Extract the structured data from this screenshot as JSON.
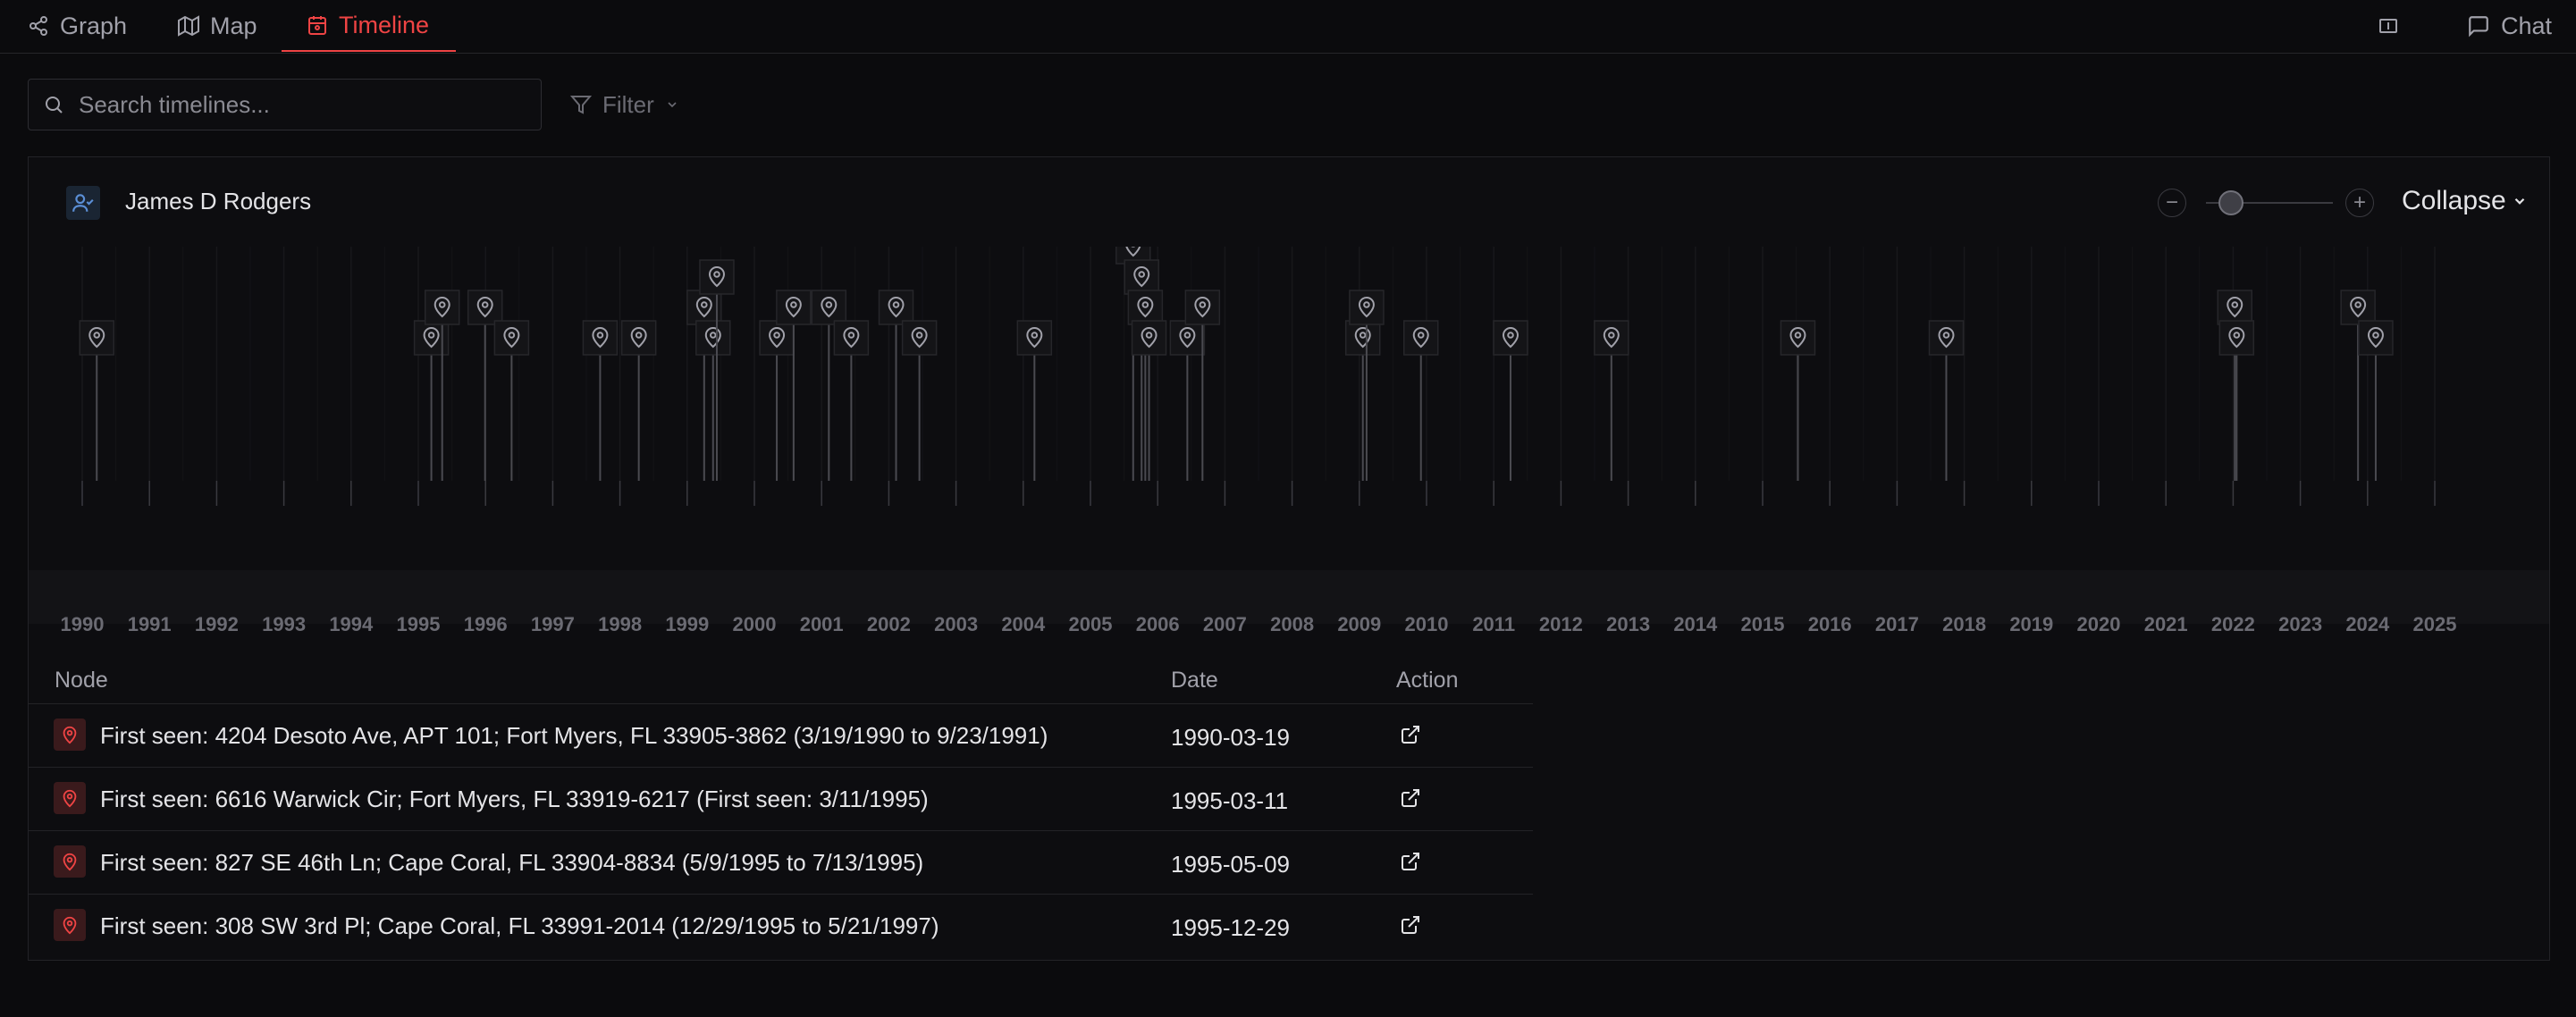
{
  "tabs": [
    {
      "label": "Graph",
      "icon": "graph-icon",
      "active": false
    },
    {
      "label": "Map",
      "icon": "map-icon",
      "active": false
    },
    {
      "label": "Timeline",
      "icon": "calendar-icon",
      "active": true
    }
  ],
  "header_right": {
    "chat_label": "Chat"
  },
  "search": {
    "placeholder": "Search timelines...",
    "value": ""
  },
  "filter": {
    "label": "Filter"
  },
  "timeline": {
    "person_name": "James D Rodgers",
    "collapse_label": "Collapse",
    "zoom_level": 0.2,
    "years": [
      "1990",
      "1991",
      "1992",
      "1993",
      "1994",
      "1995",
      "1996",
      "1997",
      "1998",
      "1999",
      "2000",
      "2001",
      "2002",
      "2003",
      "2004",
      "2005",
      "2006",
      "2007",
      "2008",
      "2009",
      "2010",
      "2011",
      "2012",
      "2013",
      "2014",
      "2015",
      "2016",
      "2017",
      "2018",
      "2019",
      "2020",
      "2021",
      "2022",
      "2023",
      "2024",
      "2025"
    ],
    "events": [
      {
        "date": "1990-03-19",
        "tier": 0
      },
      {
        "date": "1995-03-11",
        "tier": 0
      },
      {
        "date": "1995-05-09",
        "tier": 1
      },
      {
        "date": "1995-12-29",
        "tier": 1
      },
      {
        "date": "1996-05-21",
        "tier": 0
      },
      {
        "date": "1997-09-15",
        "tier": 0
      },
      {
        "date": "1998-04-12",
        "tier": 0
      },
      {
        "date": "1999-04-02",
        "tier": 1
      },
      {
        "date": "1999-05-20",
        "tier": 0
      },
      {
        "date": "1999-06-10",
        "tier": 2
      },
      {
        "date": "2000-05-01",
        "tier": 0
      },
      {
        "date": "2000-08-01",
        "tier": 1
      },
      {
        "date": "2001-02-10",
        "tier": 1
      },
      {
        "date": "2001-06-10",
        "tier": 0
      },
      {
        "date": "2002-02-10",
        "tier": 1
      },
      {
        "date": "2002-06-15",
        "tier": 0
      },
      {
        "date": "2004-03-01",
        "tier": 0
      },
      {
        "date": "2005-08-20",
        "tier": 3
      },
      {
        "date": "2005-10-05",
        "tier": 2
      },
      {
        "date": "2005-10-25",
        "tier": 1
      },
      {
        "date": "2005-11-15",
        "tier": 0
      },
      {
        "date": "2006-06-10",
        "tier": 0
      },
      {
        "date": "2006-09-01",
        "tier": 1
      },
      {
        "date": "2009-00-20",
        "tier": 0
      },
      {
        "date": "2009-02-10",
        "tier": 1
      },
      {
        "date": "2009-12-01",
        "tier": 0
      },
      {
        "date": "2011-04-01",
        "tier": 0
      },
      {
        "date": "2012-10-01",
        "tier": 0
      },
      {
        "date": "2015-07-10",
        "tier": 0
      },
      {
        "date": "2017-09-25",
        "tier": 0
      },
      {
        "date": "2022-01-10",
        "tier": 1
      },
      {
        "date": "2022-01-20",
        "tier": 0
      },
      {
        "date": "2023-11-10",
        "tier": 1
      },
      {
        "date": "2024-02-15",
        "tier": 0
      }
    ]
  },
  "table": {
    "headers": {
      "node": "Node",
      "date": "Date",
      "action": "Action"
    },
    "rows": [
      {
        "node": "First seen: 4204 Desoto Ave, APT 101; Fort Myers, FL 33905-3862 (3/19/1990 to 9/23/1991)",
        "date": "1990-03-19"
      },
      {
        "node": "First seen: 6616 Warwick Cir; Fort Myers, FL 33919-6217 (First seen: 3/11/1995)",
        "date": "1995-03-11"
      },
      {
        "node": "First seen: 827 SE 46th Ln; Cape Coral, FL 33904-8834 (5/9/1995 to 7/13/1995)",
        "date": "1995-05-09"
      },
      {
        "node": "First seen: 308 SW 3rd Pl; Cape Coral, FL 33991-2014 (12/29/1995 to 5/21/1997)",
        "date": "1995-12-29"
      }
    ]
  }
}
